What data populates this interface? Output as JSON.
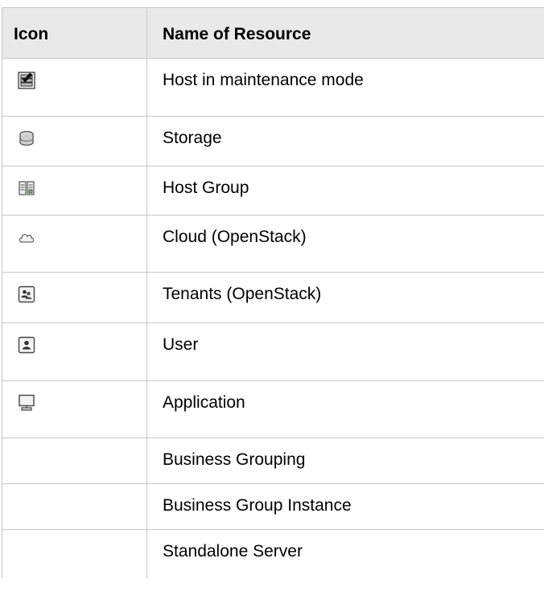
{
  "table": {
    "headers": {
      "icon": "Icon",
      "name": "Name of Resource"
    },
    "rows": [
      {
        "icon": "host-maintenance-icon",
        "name": "Host in maintenance mode"
      },
      {
        "icon": "storage-icon",
        "name": "Storage"
      },
      {
        "icon": "host-group-icon",
        "name": "Host Group"
      },
      {
        "icon": "cloud-icon",
        "name": "Cloud (OpenStack)"
      },
      {
        "icon": "tenants-icon",
        "name": "Tenants (OpenStack)"
      },
      {
        "icon": "user-icon",
        "name": "User"
      },
      {
        "icon": "application-icon",
        "name": "Application"
      },
      {
        "icon": "",
        "name": "Business Grouping"
      },
      {
        "icon": "",
        "name": "Business Group Instance"
      },
      {
        "icon": "",
        "name": "Standalone Server"
      }
    ]
  },
  "colors": {
    "header_bg": "#e9e9e9",
    "border": "#c8c8c8"
  }
}
